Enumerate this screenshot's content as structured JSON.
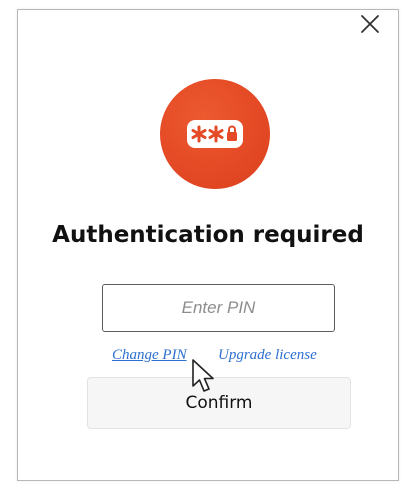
{
  "dialog": {
    "close_icon": "close-icon",
    "auth_icon": "password-key-icon",
    "title": "Authentication required",
    "pin_input": {
      "value": "",
      "placeholder": "Enter PIN"
    },
    "links": {
      "change_pin": "Change PIN",
      "upgrade_license": "Upgrade license"
    },
    "confirm_label": "Confirm"
  },
  "colors": {
    "accent": "#e44a25",
    "link": "#2b6fd1",
    "button_bg": "#f6f6f6"
  }
}
